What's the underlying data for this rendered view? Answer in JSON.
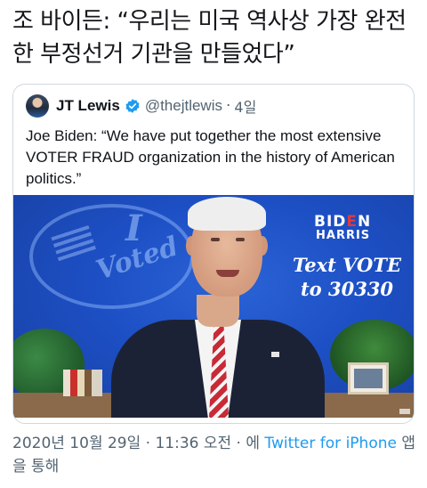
{
  "headline": "조 바이든: “우리는 미국 역사상 가장 완전한 부정선거 기관을 만들었다”",
  "quoted_tweet": {
    "display_name": "JT Lewis",
    "handle": "@thejtlewis",
    "separator": "·",
    "time": "4일",
    "text": "Joe Biden: “We have put together the most extensive VOTER FRAUD organization in the history of American politics.”",
    "media": {
      "seal_letter": "I",
      "seal_word": "Voted",
      "logo_biden_a": "BID",
      "logo_biden_cut": "E",
      "logo_biden_b": "N",
      "logo_harris": "HARRIS",
      "text_vote_line1": "Text VOTE",
      "text_vote_line2": "to 30330"
    }
  },
  "meta": {
    "timestamp": "2020년 10월 29일 · 11:36 오전 · 에",
    "source_link": "Twitter for iPhone",
    "suffix": "앱을 통해"
  },
  "colors": {
    "link": "#1d9bf0",
    "verified": "#1d9bf0",
    "secondary_text": "#536471",
    "card_border": "#cfd9de"
  },
  "icons": {
    "verified": "verified-badge-icon",
    "avatar": "avatar"
  }
}
